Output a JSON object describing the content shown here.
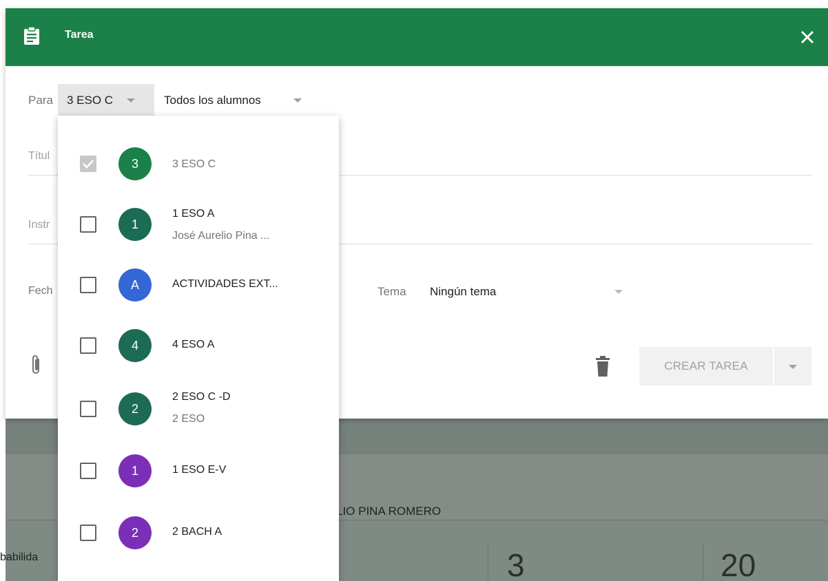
{
  "dialog": {
    "title": "Tarea",
    "para_label": "Para",
    "class_select": "3 ESO C",
    "students_select": "Todos los alumnos",
    "title_placeholder": "Títul",
    "instructions_placeholder": "Instr",
    "date_label": "Fech",
    "tema_label": "Tema",
    "tema_value": "Ningún tema",
    "create_label": "CREAR TAREA"
  },
  "dropdown": {
    "items": [
      {
        "avatar": "3",
        "name": "3 ESO C",
        "sub": "",
        "checked": true,
        "color": "#1b8148"
      },
      {
        "avatar": "1",
        "name": "1 ESO A",
        "sub": "José Aurelio Pina ...",
        "checked": false,
        "color": "#1c6b55"
      },
      {
        "avatar": "A",
        "name": "ACTIVIDADES EXT...",
        "sub": "",
        "checked": false,
        "color": "#3367d6"
      },
      {
        "avatar": "4",
        "name": "4 ESO A",
        "sub": "",
        "checked": false,
        "color": "#1c6b55"
      },
      {
        "avatar": "2",
        "name": "2 ESO C -D",
        "sub": "2 ESO",
        "checked": false,
        "color": "#1c6b55"
      },
      {
        "avatar": "1",
        "name": "1 ESO E-V",
        "sub": "",
        "checked": false,
        "color": "#7b2fb8"
      },
      {
        "avatar": "2",
        "name": "2 BACH A",
        "sub": "",
        "checked": false,
        "color": "#7b2fb8"
      }
    ]
  },
  "background": {
    "owner_fragment": "LIO PINA ROMERO",
    "left_fragment": "babilida",
    "number_1": "3",
    "number_2": "20"
  },
  "colors": {
    "header": "#1b8148",
    "accent_text": "#202124"
  },
  "icons": {
    "header": "clipboard-icon",
    "close": "close-icon",
    "attach": "paperclip-icon",
    "delete": "trash-icon",
    "caret": "caret-down-icon",
    "check": "check-icon"
  }
}
